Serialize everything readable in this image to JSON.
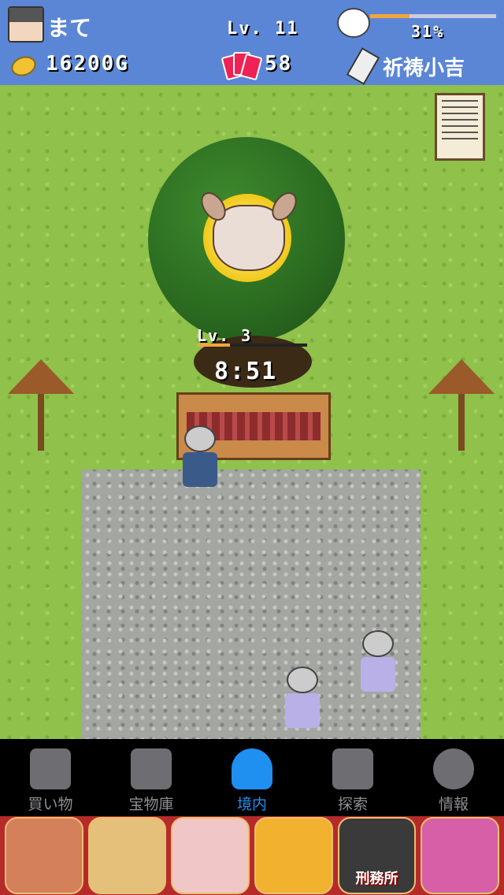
{
  "hud": {
    "player_name": "まて",
    "level": "Lv. 11",
    "progress_percent": 31,
    "progress_label": "31%",
    "gold": "16200G",
    "cards": "58",
    "fortune": "祈祷小吉"
  },
  "scene": {
    "sacred_tree_level": "Lv. 3",
    "sacred_tree_progress": 0.3,
    "timer": "8:51"
  },
  "tabs": [
    {
      "label": "買い物",
      "icon": "shop-icon"
    },
    {
      "label": "宝物庫",
      "icon": "treasure-chest-icon"
    },
    {
      "label": "境内",
      "icon": "tree-icon",
      "active": true
    },
    {
      "label": "探索",
      "icon": "footprints-icon"
    },
    {
      "label": "情報",
      "icon": "info-icon"
    }
  ],
  "ads": {
    "prison_label": "刑務所"
  },
  "colors": {
    "hud_bg": "#5b86d6",
    "active_tab": "#1f8ff0",
    "progress": "#f3a53c"
  }
}
